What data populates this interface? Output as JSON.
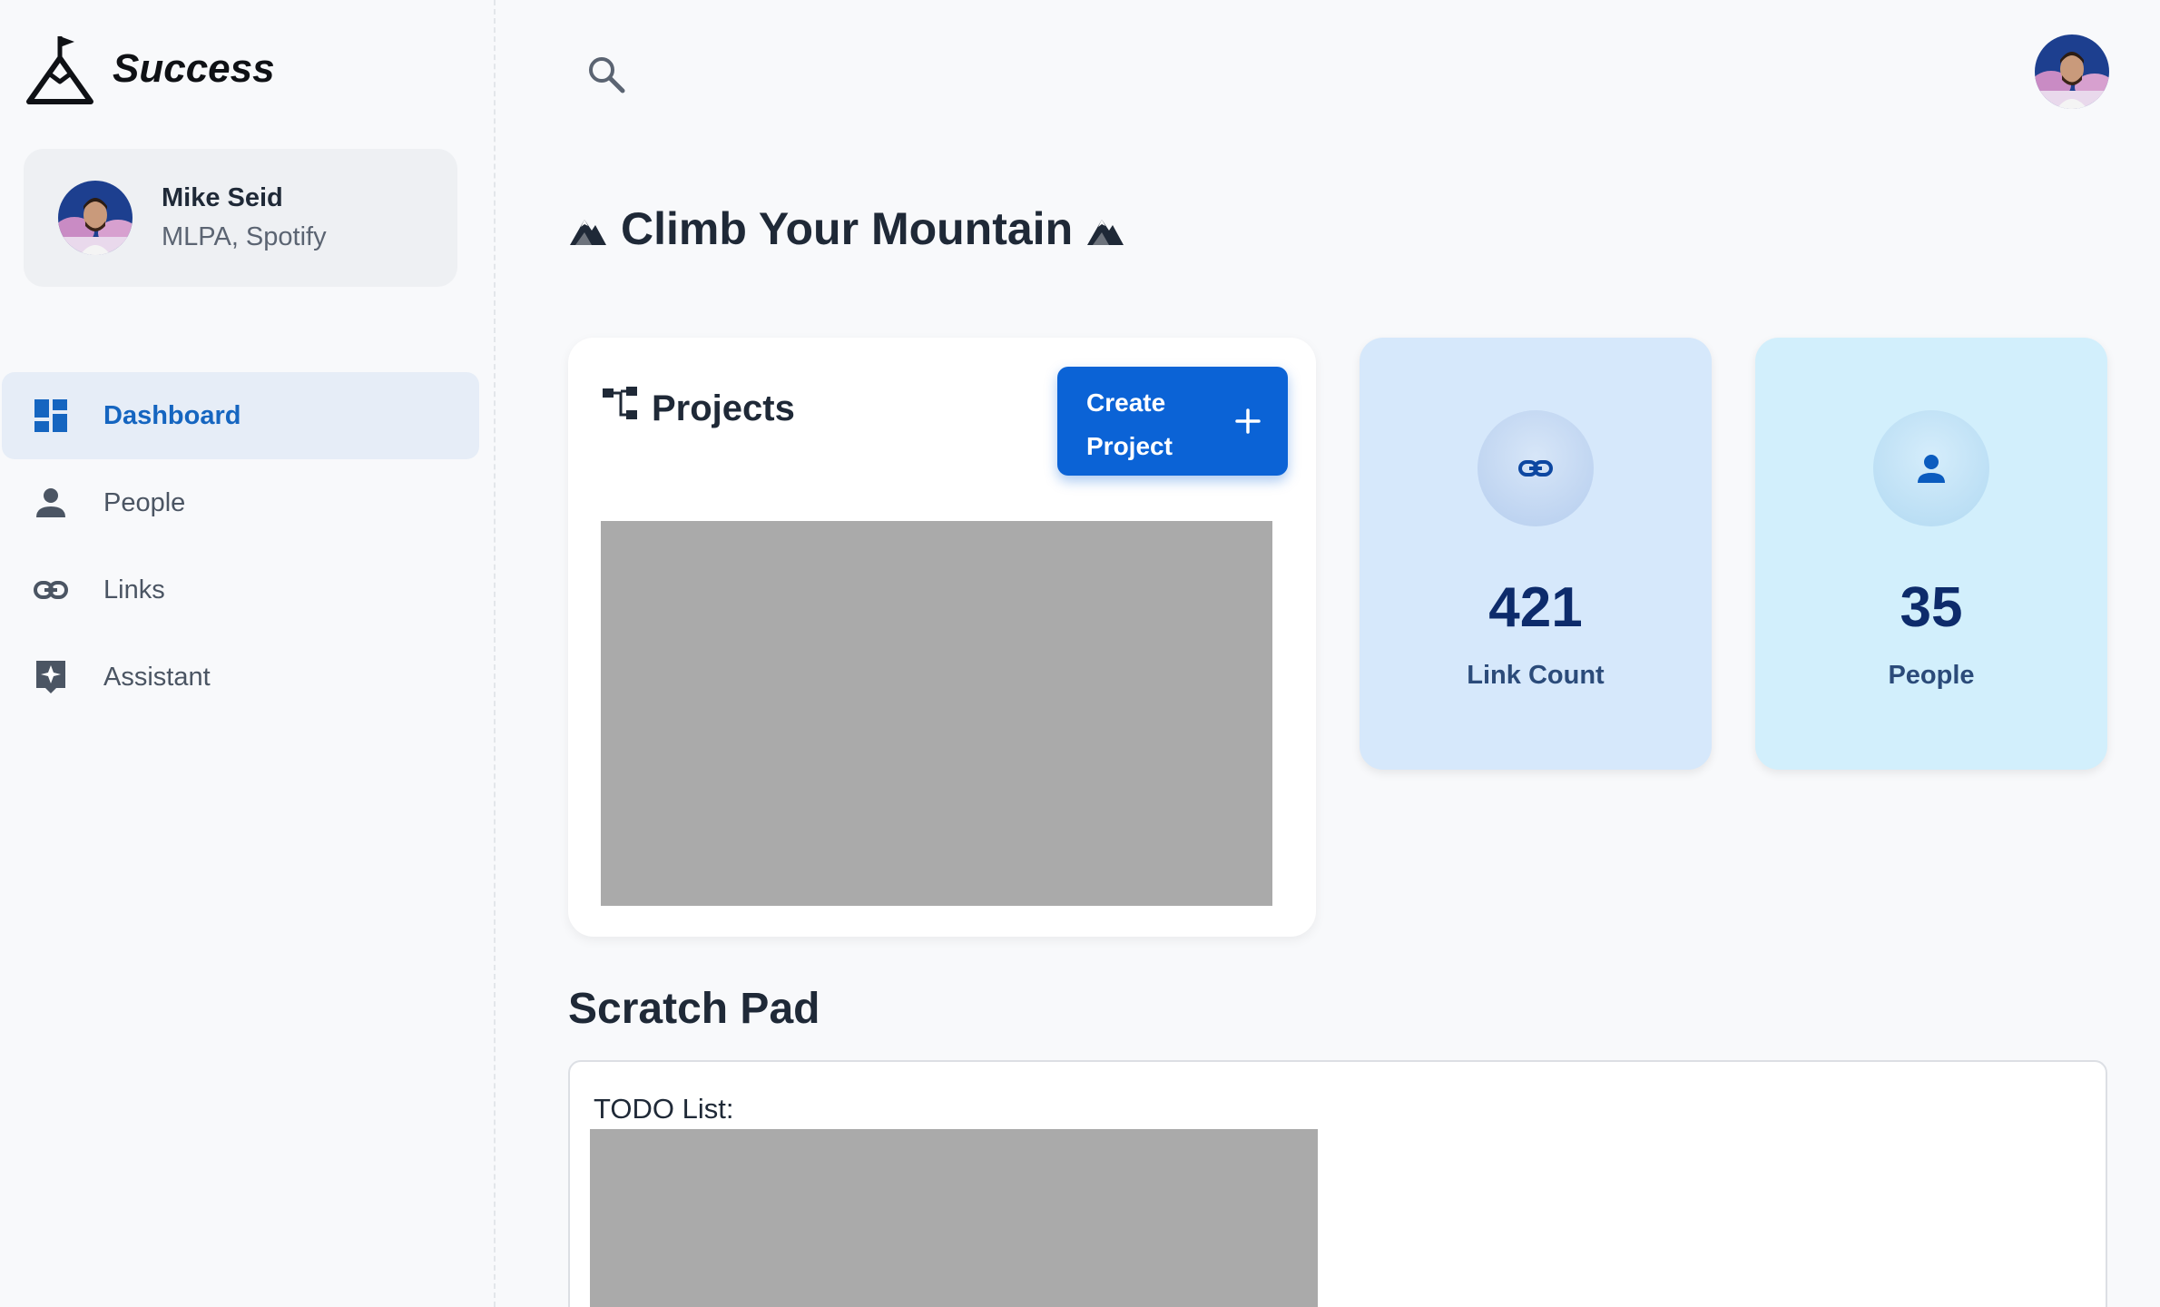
{
  "brand": {
    "name": "Success",
    "logo": "mountain-flag-logo"
  },
  "user": {
    "name": "Mike Seid",
    "org": "MLPA, Spotify"
  },
  "nav": {
    "items": [
      {
        "label": "Dashboard",
        "icon": "dashboard-icon",
        "active": true
      },
      {
        "label": "People",
        "icon": "person-icon",
        "active": false
      },
      {
        "label": "Links",
        "icon": "link-icon",
        "active": false
      },
      {
        "label": "Assistant",
        "icon": "sparkle-chat-icon",
        "active": false
      }
    ]
  },
  "header": {
    "search_icon": "search-icon"
  },
  "page": {
    "title": "Climb Your Mountain",
    "title_icon": "mountain-icon"
  },
  "projects": {
    "title": "Projects",
    "icon": "account-tree-icon",
    "create_button_label": "Create Project"
  },
  "stats": {
    "links": {
      "value": "421",
      "label": "Link Count",
      "icon": "link-icon"
    },
    "people": {
      "value": "35",
      "label": "People",
      "icon": "person-icon"
    }
  },
  "scratch_pad": {
    "title": "Scratch Pad",
    "todo_label": "TODO List:"
  },
  "colors": {
    "accent": "#0b63d6",
    "nav_active_bg": "#e6edf7",
    "links_card_bg": "#d6e8fb",
    "people_card_bg": "#d2effc",
    "stat_value": "#0d2b6b"
  }
}
